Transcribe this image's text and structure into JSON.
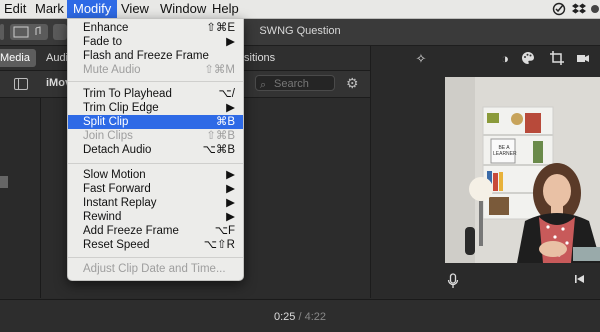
{
  "menubar": {
    "items": [
      "Edit",
      "Mark",
      "Modify",
      "View",
      "Window",
      "Help"
    ]
  },
  "window": {
    "title": "SWNG Question"
  },
  "tabs": {
    "media": "Media",
    "audio": "Audi",
    "transitions": "sitions"
  },
  "library": {
    "title": "iMov",
    "search_placeholder": "Search"
  },
  "menu": {
    "items": [
      {
        "label": "Enhance",
        "shortcut": "⇧⌘E",
        "disabled": false
      },
      {
        "label": "Fade to",
        "shortcut": "▶",
        "disabled": false
      },
      {
        "label": "Flash and Freeze Frame",
        "shortcut": "",
        "disabled": false
      },
      {
        "label": "Mute Audio",
        "shortcut": "⇧⌘M",
        "disabled": true
      },
      {
        "label": "Trim To Playhead",
        "shortcut": "⌥/",
        "disabled": false
      },
      {
        "label": "Trim Clip Edge",
        "shortcut": "▶",
        "disabled": false
      },
      {
        "label": "Split Clip",
        "shortcut": "⌘B",
        "disabled": false,
        "highlighted": true
      },
      {
        "label": "Join Clips",
        "shortcut": "⇧⌘B",
        "disabled": true
      },
      {
        "label": "Detach Audio",
        "shortcut": "⌥⌘B",
        "disabled": false
      },
      {
        "label": "Slow Motion",
        "shortcut": "▶",
        "disabled": false
      },
      {
        "label": "Fast Forward",
        "shortcut": "▶",
        "disabled": false
      },
      {
        "label": "Instant Replay",
        "shortcut": "▶",
        "disabled": false
      },
      {
        "label": "Rewind",
        "shortcut": "▶",
        "disabled": false
      },
      {
        "label": "Add Freeze Frame",
        "shortcut": "⌥F",
        "disabled": false
      },
      {
        "label": "Reset Speed",
        "shortcut": "⌥⇧R",
        "disabled": false
      },
      {
        "label": "Adjust Clip Date and Time...",
        "shortcut": "",
        "disabled": true
      }
    ]
  },
  "video": {
    "poster_text": "BE A LEARNER"
  },
  "timecode": {
    "current": "0:25",
    "separator": "/",
    "total": "4:22"
  },
  "colors": {
    "accent": "#2e6ae6",
    "dark_panel": "#2b2b2b"
  }
}
